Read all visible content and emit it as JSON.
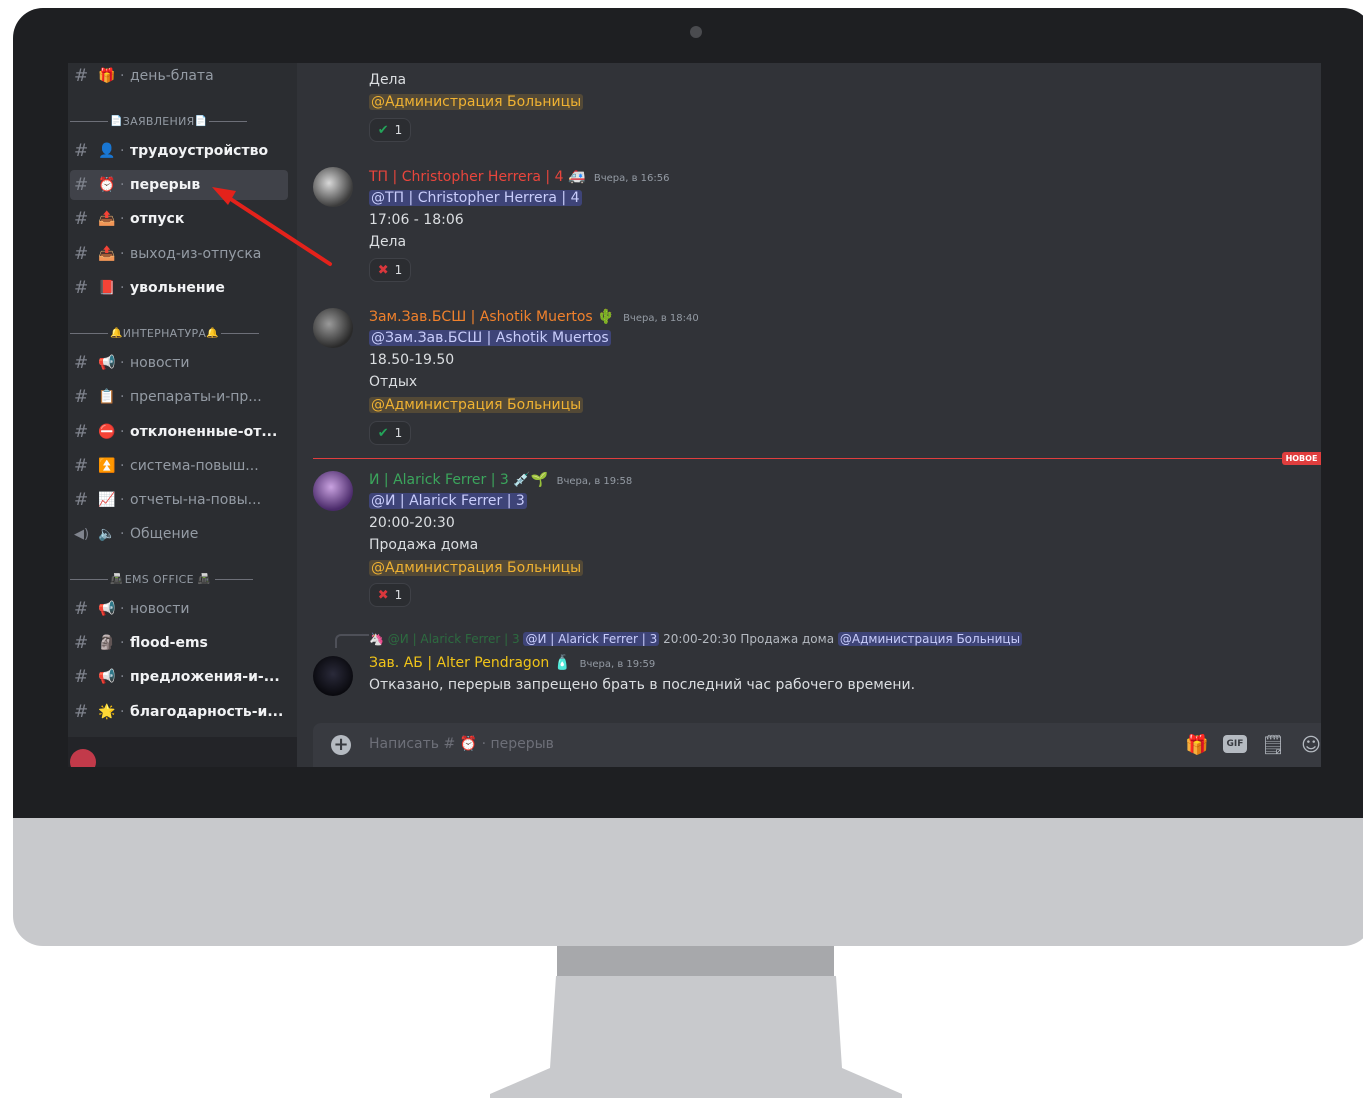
{
  "sidebar": {
    "channels": [
      {
        "emoji": "🎁",
        "name": "день-блата"
      },
      {
        "emoji": "👤",
        "name": "трудоустройство"
      },
      {
        "emoji": "⏰",
        "name": "перерыв"
      },
      {
        "emoji": "📤",
        "name": "отпуск"
      },
      {
        "emoji": "📤",
        "name": "выход-из-отпуска"
      },
      {
        "emoji": "📕",
        "name": "увольнение"
      },
      {
        "emoji": "📢",
        "name": "новости"
      },
      {
        "emoji": "📋",
        "name": "препараты-и-пр..."
      },
      {
        "emoji": "⛔",
        "name": "отклоненные-от..."
      },
      {
        "emoji": "⏫",
        "name": "система-повыш..."
      },
      {
        "emoji": "📈",
        "name": "отчеты-на-повы..."
      },
      {
        "emoji": "🔈",
        "name": "Общение"
      },
      {
        "emoji": "📢",
        "name": "новости"
      },
      {
        "emoji": "🗿",
        "name": "flood-ems"
      },
      {
        "emoji": "📢",
        "name": "предложения-и-..."
      },
      {
        "emoji": "🌟",
        "name": "благодарность-и..."
      }
    ],
    "categories": [
      {
        "icon": "📄",
        "label": "ЗАЯВЛЕНИЯ"
      },
      {
        "icon": "🔔",
        "label": "ИНТЕРНАТУРА"
      },
      {
        "icon": "📠",
        "label": "EMS OFFICE"
      }
    ]
  },
  "chat": {
    "m0": {
      "line1": "Дела",
      "role": "@Администрация Больницы",
      "react_count": "1"
    },
    "m1": {
      "name": "ТП | Christopher Herrera | 4",
      "badge": "🚑",
      "time": "Вчера, в 16:56",
      "mention": "@ТП | Christopher Herrera | 4",
      "line1": "17:06 - 18:06",
      "line2": "Дела",
      "react_count": "1"
    },
    "m2": {
      "name": "Зам.Зав.БСШ | Ashotik Muertos",
      "badge": "🌵",
      "time": "Вчера, в 18:40",
      "mention": "@Зам.Зав.БСШ | Ashotik Muertos",
      "line1": "18.50-19.50",
      "line2": "Отдых",
      "role": "@Администрация Больницы",
      "react_count": "1"
    },
    "new_label": "НОВОЕ",
    "m3": {
      "name": "И | Alarick Ferrer | 3",
      "badge": "💉🌱",
      "time": "Вчера, в 19:58",
      "mention": "@И | Alarick Ferrer | 3",
      "line1": "20:00-20:30",
      "line2": "Продажа дома",
      "role": "@Администрация Больницы",
      "react_count": "1"
    },
    "reply": {
      "name": "@И | Alarick Ferrer | 3",
      "mention": "@И | Alarick Ferrer | 3",
      "text": "20:00-20:30 Продажа дома",
      "role": "@Администрация Больницы"
    },
    "m4": {
      "name": "Зав. АБ | Alter Pendragon",
      "badge": "🧴",
      "time": "Вчера, в 19:59",
      "text": "Отказано, перерыв запрещено брать в последний час рабочего времени."
    }
  },
  "composer": {
    "prefix": "Написать #",
    "emoji": "⏰",
    "channel": "· перерыв",
    "gif_label": "GIF"
  },
  "colors": {
    "red_name": "#e8453c",
    "orange_name": "#f0812c",
    "green_name": "#3ba55c",
    "gold_name": "#f0c419",
    "arrow": "#e4221b"
  },
  "icons": {
    "channel": "hash-icon",
    "voice": "speaker-icon",
    "add": "plus-circle-icon",
    "gift": "gift-icon",
    "sticker": "sticker-icon",
    "emoji": "smile-icon"
  }
}
